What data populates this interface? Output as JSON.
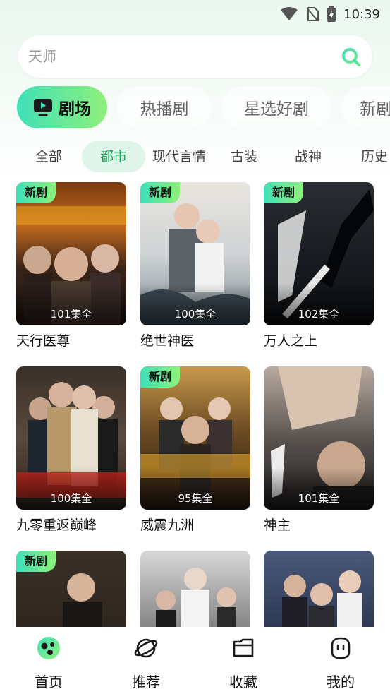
{
  "status_bar": {
    "time": "10:39"
  },
  "search": {
    "placeholder": "天师"
  },
  "primary_tabs": [
    "剧场",
    "热播剧",
    "星选好剧",
    "新剧"
  ],
  "sub_tabs": [
    "全部",
    "都市",
    "现代言情",
    "古装",
    "战神",
    "历史"
  ],
  "dramas": [
    {
      "title": "天行医尊",
      "episodes": "101集全",
      "badge": "新剧"
    },
    {
      "title": "绝世神医",
      "episodes": "100集全",
      "badge": "新剧"
    },
    {
      "title": "万人之上",
      "episodes": "102集全",
      "badge": "新剧"
    },
    {
      "title": "九零重返巅峰",
      "episodes": "100集全",
      "badge": ""
    },
    {
      "title": "威震九洲",
      "episodes": "95集全",
      "badge": "新剧"
    },
    {
      "title": "神主",
      "episodes": "101集全",
      "badge": ""
    },
    {
      "title": "",
      "episodes": "",
      "badge": "新剧"
    },
    {
      "title": "",
      "episodes": "",
      "badge": ""
    },
    {
      "title": "",
      "episodes": "",
      "badge": ""
    }
  ],
  "bottom_nav": [
    {
      "label": "首页",
      "icon": "home-icon",
      "active": true
    },
    {
      "label": "推荐",
      "icon": "planet-icon",
      "active": false
    },
    {
      "label": "收藏",
      "icon": "folder-icon",
      "active": false
    },
    {
      "label": "我的",
      "icon": "profile-icon",
      "active": false
    }
  ],
  "colors": {
    "accent_start": "#3fe0b8",
    "accent_end": "#8ef07a",
    "active_sub_tab": "#18a35a"
  }
}
